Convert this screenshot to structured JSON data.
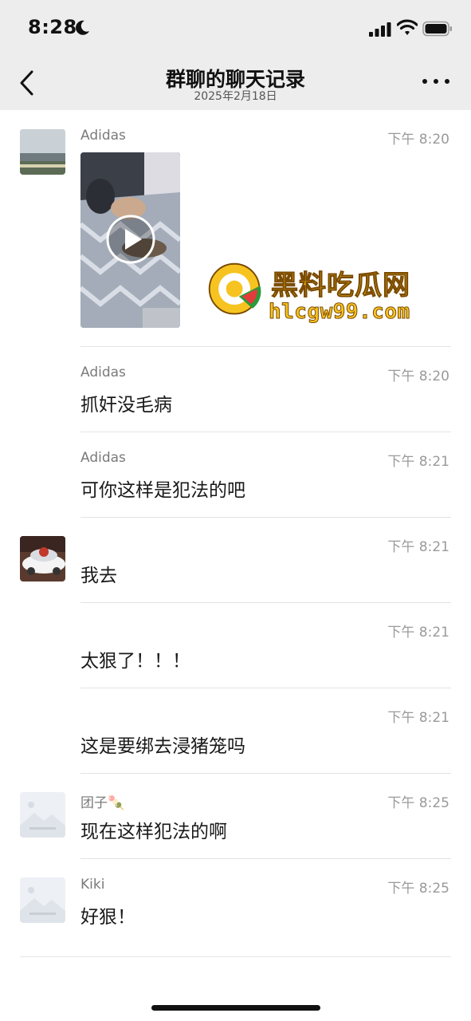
{
  "status_bar": {
    "time": "8:28"
  },
  "header": {
    "title": "群聊的聊天记录",
    "date": "2025年2月18日"
  },
  "messages": [
    {
      "sender": "Adidas",
      "time": "下午 8:20",
      "type": "video",
      "text": ""
    },
    {
      "sender": "Adidas",
      "time": "下午 8:20",
      "type": "text",
      "text": "抓奸没毛病"
    },
    {
      "sender": "Adidas",
      "time": "下午 8:21",
      "type": "text",
      "text": "可你这样是犯法的吧"
    },
    {
      "sender": "",
      "time": "下午 8:21",
      "type": "text",
      "text": "我去"
    },
    {
      "sender": "",
      "time": "下午 8:21",
      "type": "text",
      "text": "太狠了！！！"
    },
    {
      "sender": "",
      "time": "下午 8:21",
      "type": "text",
      "text": "这是要绑去浸猪笼吗"
    },
    {
      "sender": "团子🍡",
      "time": "下午 8:25",
      "type": "text",
      "text": "现在这样犯法的啊"
    },
    {
      "sender": "Kiki",
      "time": "下午 8:25",
      "type": "text",
      "text": "好狠！"
    }
  ],
  "watermark": {
    "name": "黑料吃瓜网",
    "url": "hlcgw99.com"
  },
  "icons": {
    "moon": "moon-icon",
    "signal": "cellular-signal-icon",
    "wifi": "wifi-icon",
    "battery": "battery-icon",
    "back": "chevron-left-icon",
    "more": "more-dots-icon",
    "play": "play-icon"
  },
  "colors": {
    "header_bg": "#ededed",
    "text": "#1a1a1a",
    "meta": "#9a9a9a",
    "watermark": "#f7c320"
  }
}
